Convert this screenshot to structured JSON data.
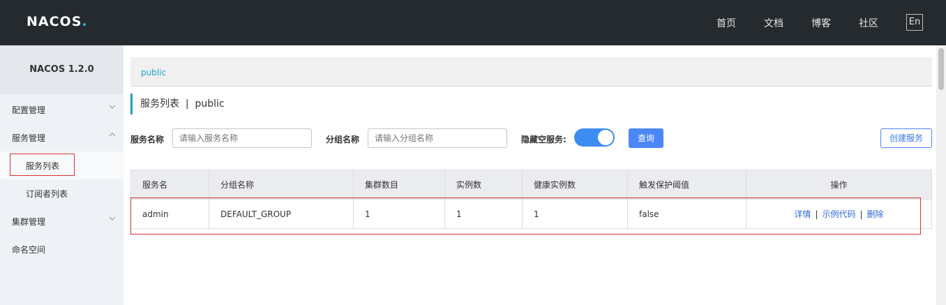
{
  "header": {
    "logo": "NACOS",
    "logo_dot": ".",
    "nav": [
      "首页",
      "文档",
      "博客",
      "社区"
    ],
    "lang": "En"
  },
  "sidebar": {
    "version": "NACOS 1.2.0",
    "items": [
      {
        "label": "配置管理"
      },
      {
        "label": "服务管理"
      },
      {
        "label": "服务列表"
      },
      {
        "label": "订阅者列表"
      },
      {
        "label": "集群管理"
      },
      {
        "label": "命名空间"
      }
    ]
  },
  "breadcrumb": "public",
  "page_title": "服务列表  |  public",
  "filters": {
    "service_name_label": "服务名称",
    "service_name_placeholder": "请输入服务名称",
    "group_name_label": "分组名称",
    "group_name_placeholder": "请输入分组名称",
    "hide_empty_label": "隐藏空服务:",
    "hide_empty_on": true,
    "query_button": "查询",
    "create_button": "创建服务"
  },
  "table": {
    "headers": [
      "服务名",
      "分组名称",
      "集群数目",
      "实例数",
      "健康实例数",
      "触发保护阈值",
      "操作"
    ],
    "rows": [
      {
        "name": "admin",
        "group": "DEFAULT_GROUP",
        "clusters": "1",
        "instances": "1",
        "healthy": "1",
        "threshold": "false",
        "ops": [
          "详情",
          "示例代码",
          "删除"
        ]
      }
    ]
  },
  "colors": {
    "header_bg": "#252a2f",
    "accent": "#1da2c9",
    "primary": "#4b87f7",
    "highlight": "#d9312f"
  }
}
